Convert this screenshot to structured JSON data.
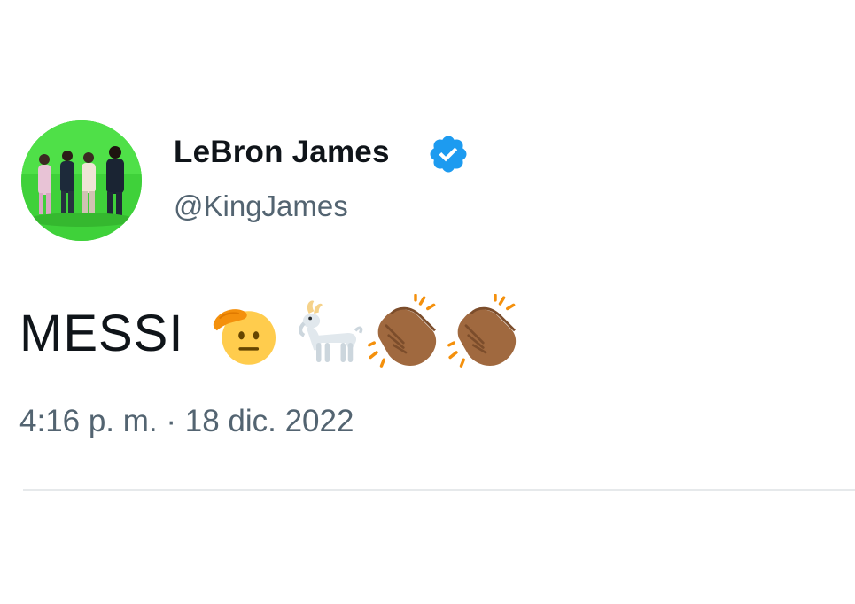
{
  "tweet": {
    "author": {
      "display_name": "LeBron James",
      "handle": "@KingJames",
      "verified": true,
      "avatar_icon": "avatar-photo"
    },
    "text": "MESSI",
    "emojis": [
      {
        "name": "saluting-face-emoji"
      },
      {
        "name": "goat-emoji"
      },
      {
        "name": "clapping-hands-emoji"
      },
      {
        "name": "clapping-hands-emoji"
      }
    ],
    "timestamp": "4:16 p. m. · 18 dic. 2022"
  },
  "colors": {
    "text": "#0f1419",
    "secondary": "#536471",
    "verified_blue": "#1d9bf0",
    "divider": "#e6e9eb",
    "avatar_background": "#3fd13a"
  }
}
